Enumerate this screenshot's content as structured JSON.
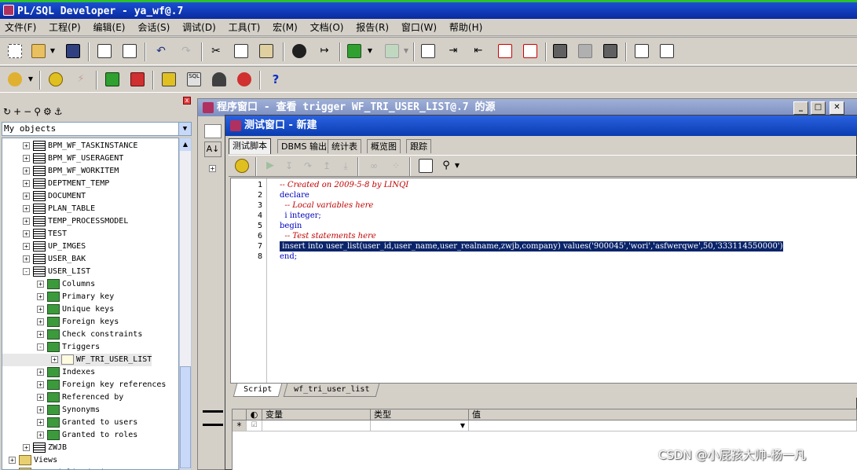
{
  "app": {
    "title": "PL/SQL Developer - ya_wf@.7"
  },
  "menu": [
    "文件(F)",
    "工程(P)",
    "编辑(E)",
    "会话(S)",
    "调试(D)",
    "工具(T)",
    "宏(M)",
    "文档(O)",
    "报告(R)",
    "窗口(W)",
    "帮助(H)"
  ],
  "object_browser": {
    "close_label": "x",
    "filter": "My objects",
    "tree": [
      {
        "label": "BPM_WF_TASKINSTANCE",
        "icon": "table-icon",
        "level": 1,
        "exp": "+"
      },
      {
        "label": "BPM_WF_USERAGENT",
        "icon": "table-icon",
        "level": 1,
        "exp": "+"
      },
      {
        "label": "BPM_WF_WORKITEM",
        "icon": "table-icon",
        "level": 1,
        "exp": "+"
      },
      {
        "label": "DEPTMENT_TEMP",
        "icon": "table-icon",
        "level": 1,
        "exp": "+"
      },
      {
        "label": "DOCUMENT",
        "icon": "table-icon",
        "level": 1,
        "exp": "+"
      },
      {
        "label": "PLAN_TABLE",
        "icon": "table-icon",
        "level": 1,
        "exp": "+"
      },
      {
        "label": "TEMP_PROCESSMODEL",
        "icon": "table-icon",
        "level": 1,
        "exp": "+"
      },
      {
        "label": "TEST",
        "icon": "table-icon",
        "level": 1,
        "exp": "+"
      },
      {
        "label": "UP_IMGES",
        "icon": "table-icon",
        "level": 1,
        "exp": "+"
      },
      {
        "label": "USER_BAK",
        "icon": "table-icon",
        "level": 1,
        "exp": "+"
      },
      {
        "label": "USER_LIST",
        "icon": "table-icon",
        "level": 1,
        "exp": "-"
      },
      {
        "label": "Columns",
        "icon": "folder-green-icon",
        "level": 2,
        "exp": "+"
      },
      {
        "label": "Primary key",
        "icon": "folder-green-icon",
        "level": 2,
        "exp": "+"
      },
      {
        "label": "Unique keys",
        "icon": "folder-green-icon",
        "level": 2,
        "exp": "+"
      },
      {
        "label": "Foreign keys",
        "icon": "folder-green-icon",
        "level": 2,
        "exp": "+"
      },
      {
        "label": "Check constraints",
        "icon": "folder-green-icon",
        "level": 2,
        "exp": "+"
      },
      {
        "label": "Triggers",
        "icon": "folder-green-icon",
        "level": 2,
        "exp": "-"
      },
      {
        "label": "WF_TRI_USER_LIST",
        "icon": "trigger-icon",
        "level": 3,
        "exp": "+",
        "selected": true
      },
      {
        "label": "Indexes",
        "icon": "folder-green-icon",
        "level": 2,
        "exp": "+"
      },
      {
        "label": "Foreign key references",
        "icon": "folder-green-icon",
        "level": 2,
        "exp": "+"
      },
      {
        "label": "Referenced by",
        "icon": "folder-green-icon",
        "level": 2,
        "exp": "+"
      },
      {
        "label": "Synonyms",
        "icon": "folder-green-icon",
        "level": 2,
        "exp": "+"
      },
      {
        "label": "Granted to users",
        "icon": "folder-green-icon",
        "level": 2,
        "exp": "+"
      },
      {
        "label": "Granted to roles",
        "icon": "folder-green-icon",
        "level": 2,
        "exp": "+"
      },
      {
        "label": "ZWJB",
        "icon": "table-icon",
        "level": 1,
        "exp": "+"
      },
      {
        "label": "Views",
        "icon": "folder-icon",
        "level": 0,
        "exp": "+"
      },
      {
        "label": "Materialized views",
        "icon": "folder-icon",
        "level": 0,
        "exp": "+"
      }
    ]
  },
  "program_window": {
    "title": "程序窗口 - 查看 trigger WF_TRI_USER_LIST@.7 的源"
  },
  "test_window": {
    "title": "测试窗口 - 新建",
    "tabs": [
      "测试脚本",
      "DBMS 输出",
      "统计表",
      "概览图",
      "跟踪"
    ],
    "code_lines": [
      {
        "n": "1",
        "text": "-- Created on 2009-5-8 by LINQI",
        "cls": "cm"
      },
      {
        "n": "2",
        "text": "declare",
        "cls": "kw"
      },
      {
        "n": "3",
        "text": "  -- Local variables here",
        "cls": "cm"
      },
      {
        "n": "4",
        "text": "  i integer;",
        "cls": "typ"
      },
      {
        "n": "5",
        "text": "begin",
        "cls": "kw"
      },
      {
        "n": "6",
        "text": "  -- Test statements here",
        "cls": "cm"
      },
      {
        "n": "7",
        "text": " insert into user_list(user_id,user_name,user_realname,zwjb,company) values('900045','wori','asfwerqwe',50,'333114550000')",
        "cls": "hl"
      },
      {
        "n": "8",
        "text": "end;",
        "cls": "kw"
      }
    ],
    "editor_tabs": [
      "Script",
      "wf_tri_user_list"
    ],
    "vars_header": [
      "变量",
      "类型",
      "值"
    ],
    "vars_row_marker": "*"
  },
  "watermark": "CSDN @小屁孩大帅-杨一凡",
  "colors": {
    "title_active": "#0a3cb0",
    "title_inactive": "#7d8fc0",
    "comment": "#c00000",
    "keyword": "#0000c0",
    "selection": "#0a246a"
  }
}
